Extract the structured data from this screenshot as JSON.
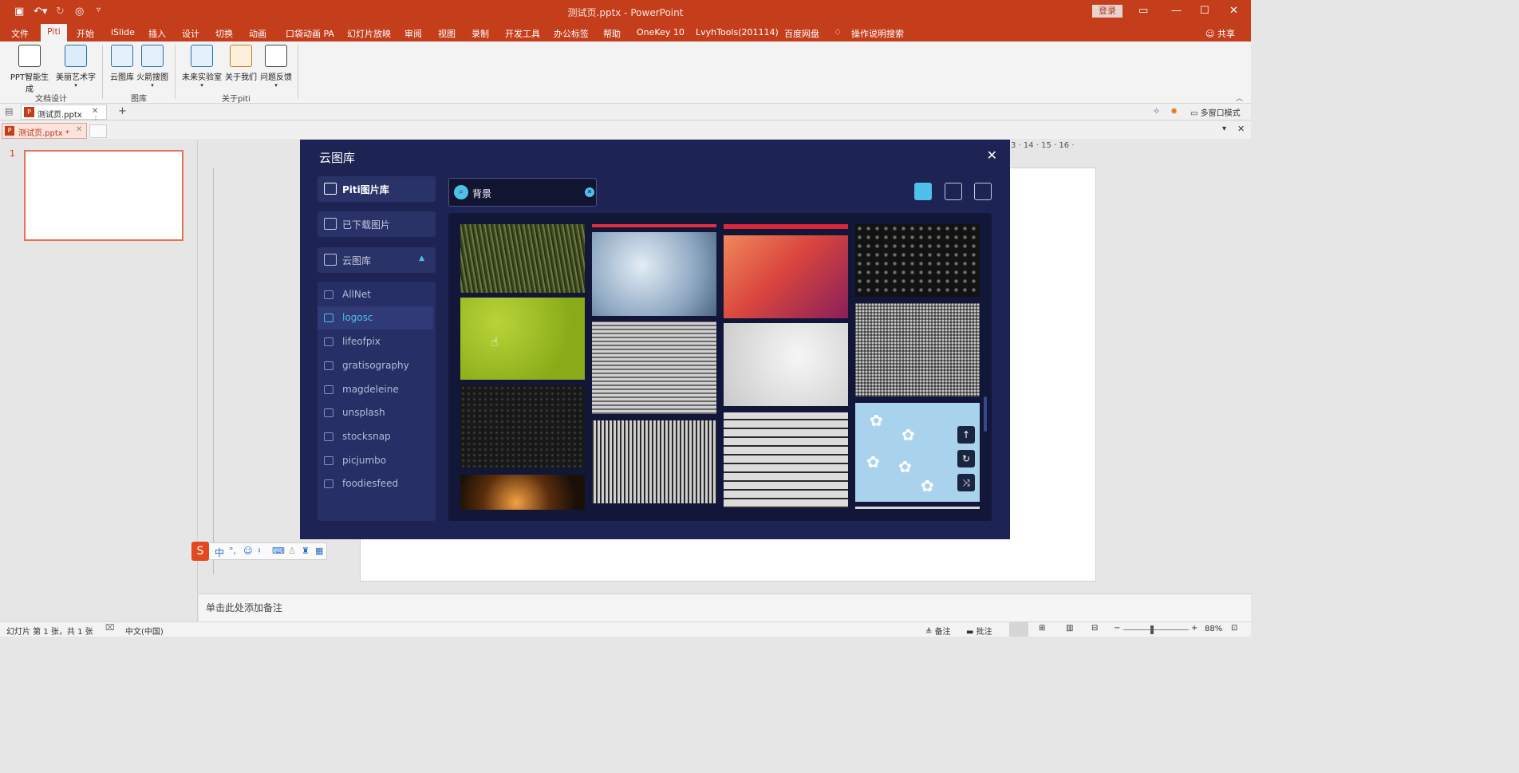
{
  "titlebar": {
    "title": "测试页.pptx - PowerPoint",
    "login": "登录"
  },
  "tabs": [
    "文件",
    "Piti",
    "开始",
    "iSlide",
    "插入",
    "设计",
    "切换",
    "动画",
    "口袋动画 PA",
    "幻灯片放映",
    "审阅",
    "视图",
    "录制",
    "开发工具",
    "办公标签",
    "帮助",
    "OneKey 10",
    "LvyhTools(201114)",
    "百度网盘",
    "操作说明搜索"
  ],
  "share": "共享",
  "ribbon": {
    "buttons": [
      "PPT智能生成",
      "美丽艺术字",
      "云图库",
      "火箭搜图",
      "未来实验室",
      "关于我们",
      "问题反馈"
    ],
    "groups": [
      "文档设计",
      "图库",
      "关于piti"
    ]
  },
  "doctabs": {
    "tab1": "测试页.pptx",
    "tab2": "测试页.pptx *",
    "multiwindow": "多窗口模式"
  },
  "slide_number": "1",
  "ruler_right": "3 · 14 · 15 · 16 ·",
  "notes_placeholder": "单击此处添加备注",
  "status": {
    "slide_info": "幻灯片 第 1 张，共 1 张",
    "language": "中文(中国)",
    "notes": "备注",
    "comments": "批注",
    "zoom": "88%"
  },
  "dialog": {
    "title": "云图库",
    "nav": [
      "Piti图片库",
      "已下载图片",
      "云图库"
    ],
    "sources": [
      "AllNet",
      "logosc",
      "lifeofpix",
      "gratisography",
      "magdeleine",
      "unsplash",
      "stocksnap",
      "picjumbo",
      "foodiesfeed"
    ],
    "active_source": "logosc",
    "search_value": "背景"
  },
  "ime": {
    "mode": "中"
  }
}
